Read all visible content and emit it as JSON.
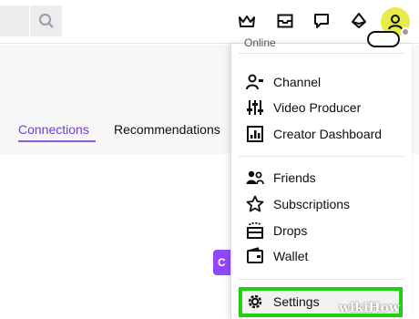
{
  "topbar": {
    "icons": [
      "search-icon",
      "crown-icon",
      "inbox-icon",
      "chat-bubble-icon",
      "bits-icon",
      "user-avatar-icon"
    ]
  },
  "tabs": [
    {
      "label": "Connections",
      "active": true
    },
    {
      "label": "Recommendations",
      "active": false
    }
  ],
  "page": {
    "primary_button_label": "C"
  },
  "dropdown": {
    "status_label": "Online",
    "groups": [
      [
        {
          "label": "Channel",
          "icon": "channel-icon"
        },
        {
          "label": "Video Producer",
          "icon": "video-producer-icon"
        },
        {
          "label": "Creator Dashboard",
          "icon": "creator-dashboard-icon"
        }
      ],
      [
        {
          "label": "Friends",
          "icon": "friends-icon"
        },
        {
          "label": "Subscriptions",
          "icon": "star-icon"
        },
        {
          "label": "Drops",
          "icon": "drops-icon"
        },
        {
          "label": "Wallet",
          "icon": "wallet-icon"
        }
      ],
      [
        {
          "label": "Settings",
          "icon": "gear-icon"
        }
      ]
    ]
  },
  "watermark": "wikiHow",
  "colors": {
    "accent": "#9147ff",
    "tab_active": "#6b3fd0",
    "highlight": "#1fd010",
    "avatar": "#e8ec4a"
  }
}
